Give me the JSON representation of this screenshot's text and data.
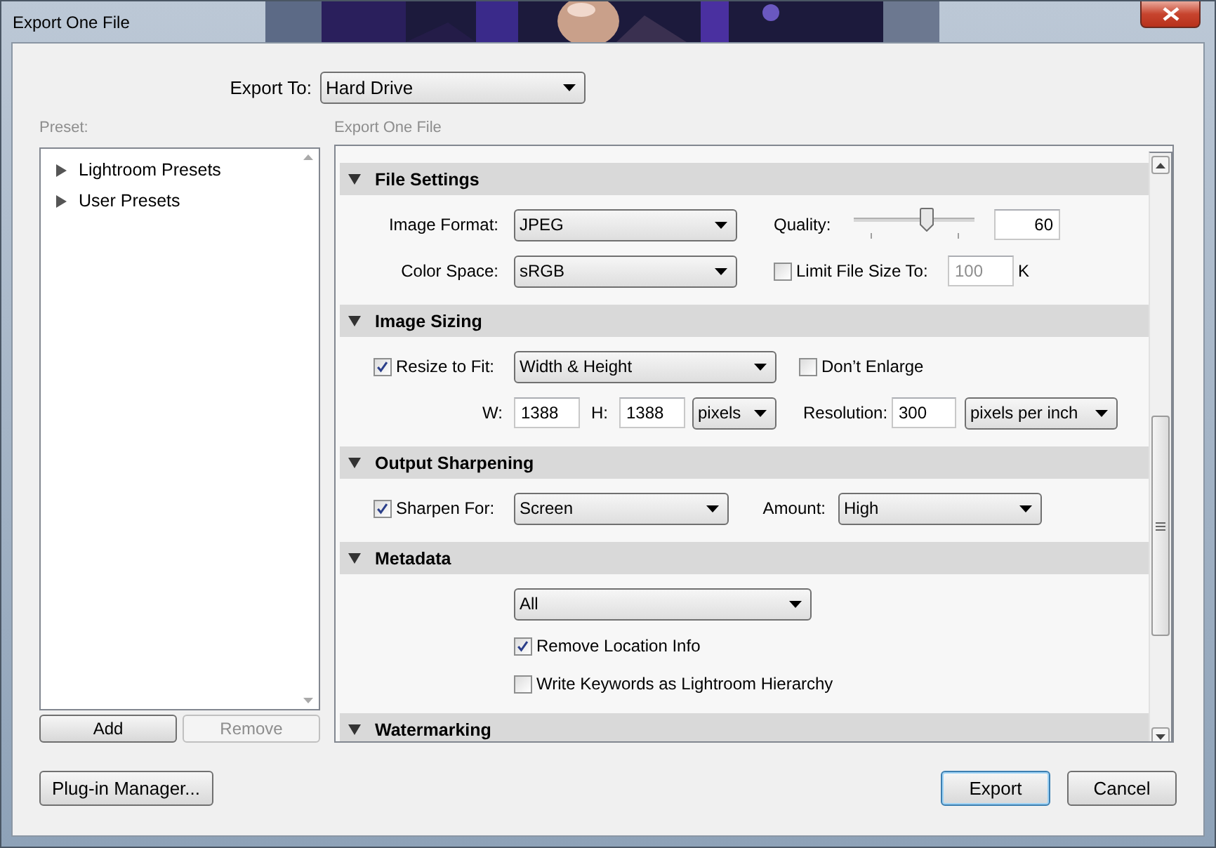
{
  "window": {
    "title": "Export One File"
  },
  "export_to": {
    "label": "Export To:",
    "value": "Hard Drive"
  },
  "preset": {
    "label": "Preset:",
    "items": [
      {
        "label": "Lightroom Presets",
        "expanded": false
      },
      {
        "label": "User Presets",
        "expanded": false
      }
    ],
    "buttons": [
      {
        "label": "Add",
        "disabled": false
      },
      {
        "label": "Remove",
        "disabled": true
      }
    ]
  },
  "settings": {
    "label": "Export One File",
    "sections": [
      {
        "title": "File Settings",
        "expanded": true,
        "rows": [
          {
            "items": [
              {
                "kind": "label",
                "text": "Image Format:"
              },
              {
                "kind": "dropdown",
                "value": "JPEG"
              },
              {
                "kind": "label",
                "text": "Quality:"
              },
              {
                "kind": "slider",
                "level": 0.6
              },
              {
                "kind": "input",
                "value": "60",
                "disabled": false
              }
            ]
          },
          {
            "items": [
              {
                "kind": "label",
                "text": "Color Space:"
              },
              {
                "kind": "dropdown",
                "value": "sRGB"
              },
              {
                "kind": "checkbox",
                "label": "Limit File Size To:",
                "checked": false
              },
              {
                "kind": "input",
                "value": "100",
                "disabled": true
              },
              {
                "kind": "label",
                "text": "K"
              }
            ]
          }
        ]
      },
      {
        "title": "Image Sizing",
        "expanded": true,
        "rows": [
          {
            "items": [
              {
                "kind": "checkbox",
                "label": "Resize to Fit:",
                "checked": true
              },
              {
                "kind": "dropdown",
                "value": "Width & Height"
              },
              {
                "kind": "checkbox",
                "label": "Don’t Enlarge",
                "checked": false
              }
            ]
          },
          {
            "items": [
              {
                "kind": "label",
                "text": "W:"
              },
              {
                "kind": "input",
                "value": "1388",
                "disabled": false
              },
              {
                "kind": "label",
                "text": "H:"
              },
              {
                "kind": "input",
                "value": "1388",
                "disabled": false
              },
              {
                "kind": "dropdown",
                "value": "pixels"
              },
              {
                "kind": "label",
                "text": "Resolution:"
              },
              {
                "kind": "input",
                "value": "300",
                "disabled": false
              },
              {
                "kind": "dropdown",
                "value": "pixels per inch"
              }
            ]
          }
        ]
      },
      {
        "title": "Output Sharpening",
        "expanded": true,
        "rows": [
          {
            "items": [
              {
                "kind": "checkbox",
                "label": "Sharpen For:",
                "checked": true
              },
              {
                "kind": "dropdown",
                "value": "Screen"
              },
              {
                "kind": "label",
                "text": "Amount:"
              },
              {
                "kind": "dropdown",
                "value": "High"
              }
            ]
          }
        ]
      },
      {
        "title": "Metadata",
        "expanded": true,
        "rows": [
          {
            "items": [
              {
                "kind": "dropdown",
                "value": "All"
              }
            ]
          },
          {
            "items": [
              {
                "kind": "checkbox",
                "label": "Remove Location Info",
                "checked": true
              }
            ]
          },
          {
            "items": [
              {
                "kind": "checkbox",
                "label": "Write Keywords as Lightroom Hierarchy",
                "checked": false
              }
            ]
          }
        ]
      },
      {
        "title": "Watermarking",
        "expanded": true
      }
    ]
  },
  "buttons": [
    {
      "label": "Plug-in Manager...",
      "default": false
    },
    {
      "label": "Export",
      "default": true
    },
    {
      "label": "Cancel",
      "default": false
    }
  ]
}
